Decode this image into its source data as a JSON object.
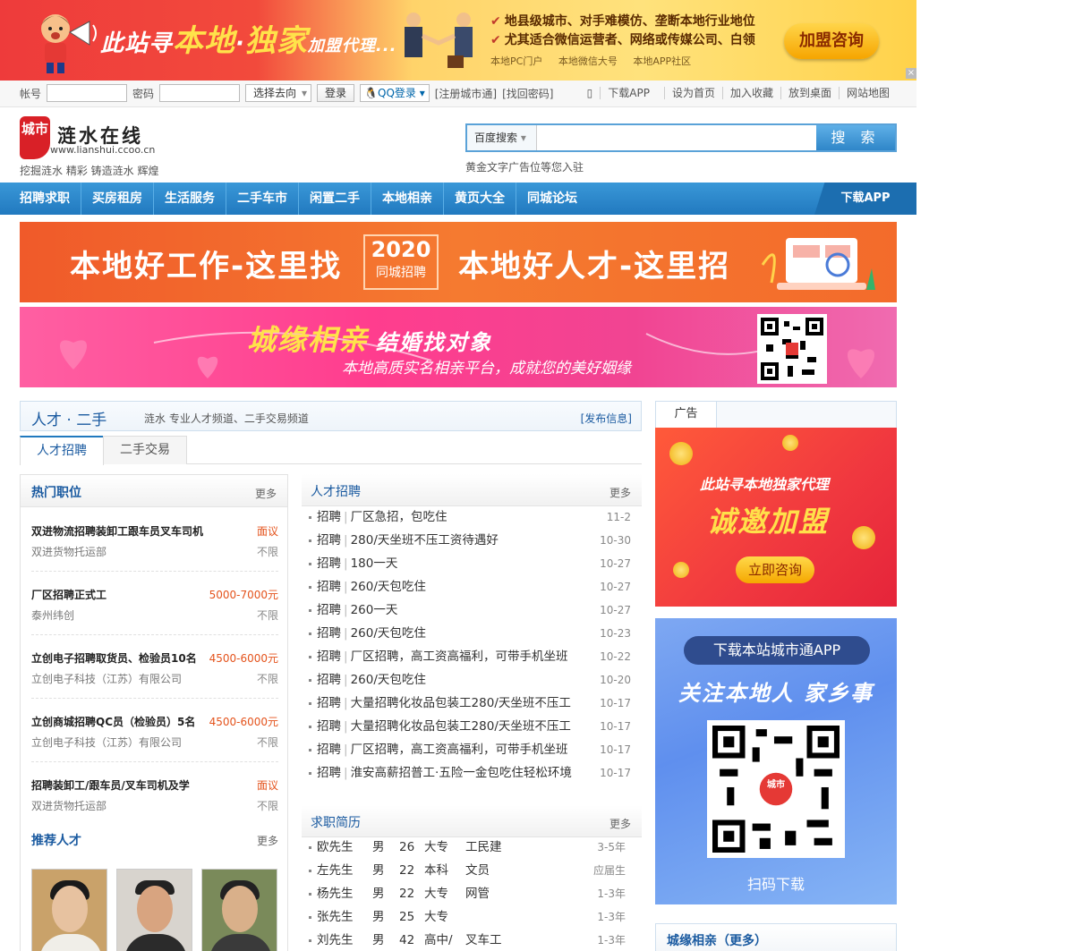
{
  "top_banner": {
    "slogan_prefix": "此站寻",
    "slogan_big1": "本地",
    "slogan_dot": "·",
    "slogan_big2": "独家",
    "slogan_suffix": "加盟代理...",
    "feature1": "地县级城市、对手难模仿、垄断本地行业地位",
    "feature2": "尤其适合微信运营者、网络或传媒公司、白领",
    "sub1": "本地PC门户",
    "sub2": "本地微信大号",
    "sub3": "本地APP社区",
    "join_button": "加盟咨询",
    "close": "×"
  },
  "login_bar": {
    "account_label": "帐号",
    "password_label": "密码",
    "destination_select": "选择去向",
    "login_button": "登录",
    "qq_login": "QQ登录",
    "register": "[注册城市通]",
    "recover": "[找回密码]",
    "links": [
      "下载APP",
      "设为首页",
      "加入收藏",
      "放到桌面",
      "网站地图"
    ]
  },
  "header": {
    "logo_mark": "城市",
    "site_name": "涟水在线",
    "site_url": "www.lianshui.ccoo.cn",
    "tagline": "挖掘涟水 精彩 铸造涟水 辉煌",
    "search_type": "百度搜索",
    "search_button": "搜 索",
    "ad_text": "黄金文字广告位等您入驻"
  },
  "nav": {
    "items": [
      "招聘求职",
      "买房租房",
      "生活服务",
      "二手车市",
      "闲置二手",
      "本地相亲",
      "黄页大全",
      "同城论坛"
    ],
    "app": "下载APP"
  },
  "banner1": {
    "left": "本地好工作-这里找",
    "year": "2020",
    "badge": "同城招聘",
    "right": "本地好人才-这里招"
  },
  "banner2": {
    "title": "城缘相亲",
    "title_small": "结婚找对象",
    "subtitle": "本地高质实名相亲平台，成就您的美好姻缘"
  },
  "section": {
    "title": "人才 · 二手",
    "desc": "涟水 专业人才频道、二手交易频道",
    "post": "[发布信息]",
    "tabs": [
      "人才招聘",
      "二手交易"
    ]
  },
  "hot_jobs": {
    "title": "热门职位",
    "more": "更多",
    "items": [
      {
        "title": "双进物流招聘装卸工跟车员叉车司机",
        "salary": "面议",
        "company": "双进货物托运部",
        "tag": "不限"
      },
      {
        "title": "厂区招聘正式工",
        "salary": "5000-7000元",
        "company": "泰州纬创",
        "tag": "不限"
      },
      {
        "title": "立创电子招聘取货员、检验员10名",
        "salary": "4500-6000元",
        "company": "立创电子科技（江苏）有限公司",
        "tag": "不限"
      },
      {
        "title": "立创商城招聘QC员（检验员）5名",
        "salary": "4500-6000元",
        "company": "立创电子科技（江苏）有限公司",
        "tag": "不限"
      },
      {
        "title": "招聘装卸工/跟车员/叉车司机及学",
        "salary": "面议",
        "company": "双进货物托运部",
        "tag": "不限"
      }
    ]
  },
  "talent": {
    "title": "推荐人才",
    "more": "更多"
  },
  "recruit": {
    "title": "人才招聘",
    "more": "更多",
    "items": [
      {
        "cat": "招聘",
        "text": "厂区急招，包吃住",
        "date": "11-2"
      },
      {
        "cat": "招聘",
        "text": "280/天坐班不压工资待遇好",
        "date": "10-30"
      },
      {
        "cat": "招聘",
        "text": "180一天",
        "date": "10-27"
      },
      {
        "cat": "招聘",
        "text": "260/天包吃住",
        "date": "10-27"
      },
      {
        "cat": "招聘",
        "text": "260一天",
        "date": "10-27"
      },
      {
        "cat": "招聘",
        "text": "260/天包吃住",
        "date": "10-23"
      },
      {
        "cat": "招聘",
        "text": "厂区招聘，高工资高福利，可带手机坐班",
        "date": "10-22"
      },
      {
        "cat": "招聘",
        "text": "260/天包吃住",
        "date": "10-20"
      },
      {
        "cat": "招聘",
        "text": "大量招聘化妆品包装工280/天坐班不压工",
        "date": "10-17"
      },
      {
        "cat": "招聘",
        "text": "大量招聘化妆品包装工280/天坐班不压工",
        "date": "10-17"
      },
      {
        "cat": "招聘",
        "text": "厂区招聘，高工资高福利，可带手机坐班",
        "date": "10-17"
      },
      {
        "cat": "招聘",
        "text": "淮安高薪招普工·五险一金包吃住轻松环境",
        "date": "10-17"
      }
    ]
  },
  "resumes": {
    "title": "求职简历",
    "more": "更多",
    "items": [
      {
        "name": "欧先生",
        "gender": "男",
        "age": "26",
        "edu": "大专",
        "job": "工民建",
        "exp": "3-5年"
      },
      {
        "name": "左先生",
        "gender": "男",
        "age": "22",
        "edu": "本科",
        "job": "文员",
        "exp": "应届生"
      },
      {
        "name": "杨先生",
        "gender": "男",
        "age": "22",
        "edu": "大专",
        "job": "网管",
        "exp": "1-3年"
      },
      {
        "name": "张先生",
        "gender": "男",
        "age": "25",
        "edu": "大专",
        "job": "",
        "exp": "1-3年"
      },
      {
        "name": "刘先生",
        "gender": "男",
        "age": "42",
        "edu": "高中/",
        "job": "叉车工",
        "exp": "1-3年"
      }
    ]
  },
  "right": {
    "ad_tab": "广告",
    "ad1_line1": "此站寻本地独家代理",
    "ad1_line2": "诚邀加盟",
    "ad1_button": "立即咨询",
    "ad2_pill": "下载本站城市通APP",
    "ad2_slogan": "关注本地人 家乡事",
    "ad2_qr_logo": "城市",
    "ad2_scan": "扫码下载",
    "love_title": "城缘相亲（更多）"
  }
}
